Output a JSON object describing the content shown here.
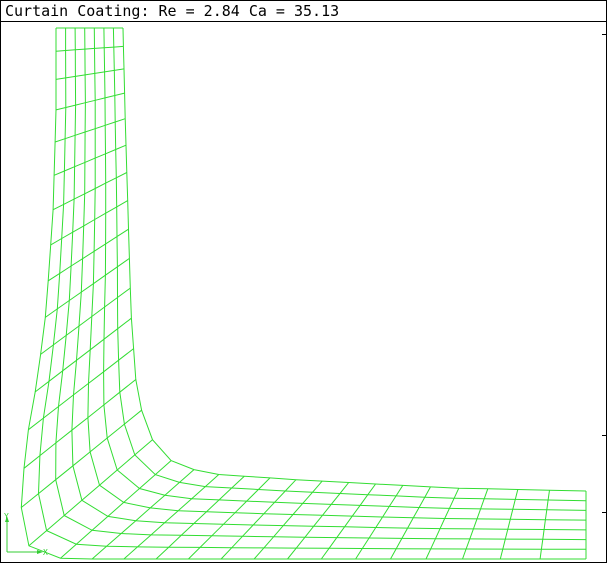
{
  "window": {
    "title": "Curtain Coating: Re = 2.84 Ca = 35.13"
  },
  "mesh": {
    "line_color": "#33dd33",
    "background": "#ffffff",
    "columns": 7,
    "rows": 31
  },
  "axes": {
    "y_label": "Y",
    "x_label": "X",
    "color": "#33cc33"
  },
  "colors": {
    "frame": "#000000"
  }
}
